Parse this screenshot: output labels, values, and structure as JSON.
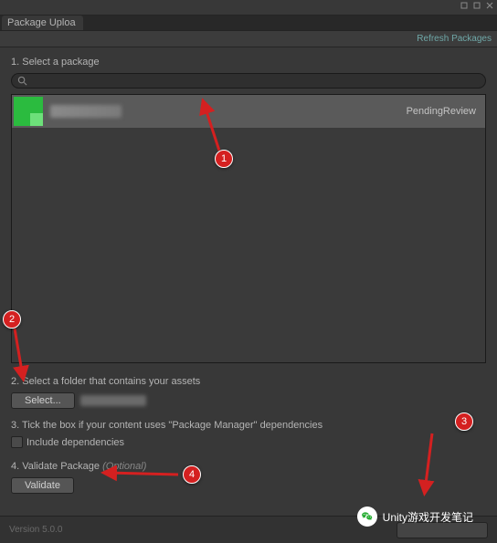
{
  "window": {
    "tab_title": "Package Uploa"
  },
  "toolbar": {
    "refresh": "Refresh Packages"
  },
  "steps": {
    "s1_label": "1. Select a package",
    "s2_label": "2. Select a folder that contains your assets",
    "s3_label": "3. Tick the box if your content uses \"Package Manager\" dependencies",
    "s3_checkbox": "Include dependencies",
    "s4_label": "4. Validate Package ",
    "s4_optional": "(Optional)"
  },
  "buttons": {
    "select": "Select...",
    "validate": "Validate"
  },
  "package": {
    "status": "PendingReview"
  },
  "footer": {
    "version": "Version 5.0.0"
  },
  "annotations": {
    "b1": "1",
    "b2": "2",
    "b3": "3",
    "b4": "4"
  },
  "watermark": {
    "text": "Unity游戏开发笔记"
  }
}
